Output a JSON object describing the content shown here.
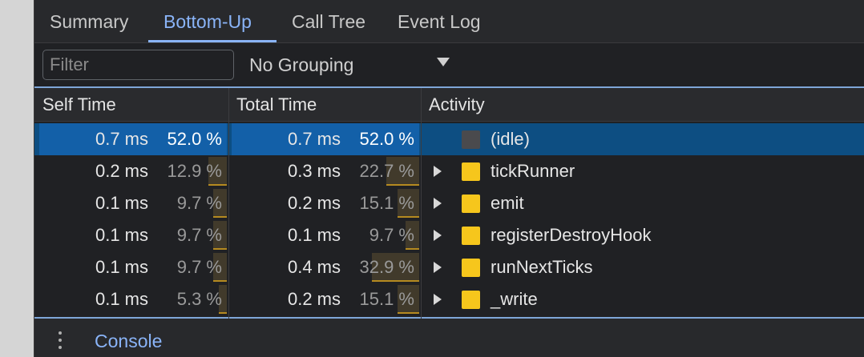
{
  "tabs": [
    {
      "label": "Summary",
      "active": false
    },
    {
      "label": "Bottom-Up",
      "active": true
    },
    {
      "label": "Call Tree",
      "active": false
    },
    {
      "label": "Event Log",
      "active": false
    }
  ],
  "toolbar": {
    "filter_placeholder": "Filter",
    "filter_value": "",
    "grouping_selected": "No Grouping"
  },
  "table": {
    "columns": [
      "Self Time",
      "Total Time",
      "Activity"
    ],
    "rows": [
      {
        "self_ms": "0.7 ms",
        "self_pct": "52.0 %",
        "self_frac": 0.52,
        "total_ms": "0.7 ms",
        "total_pct": "52.0 %",
        "total_frac": 0.52,
        "activity": "(idle)",
        "expandable": false,
        "swatch": "#4a4a4d",
        "selected": true
      },
      {
        "self_ms": "0.2 ms",
        "self_pct": "12.9 %",
        "self_frac": 0.129,
        "total_ms": "0.3 ms",
        "total_pct": "22.7 %",
        "total_frac": 0.227,
        "activity": "tickRunner",
        "expandable": true,
        "swatch": "#f6c61c",
        "selected": false
      },
      {
        "self_ms": "0.1 ms",
        "self_pct": "9.7 %",
        "self_frac": 0.097,
        "total_ms": "0.2 ms",
        "total_pct": "15.1 %",
        "total_frac": 0.151,
        "activity": "emit",
        "expandable": true,
        "swatch": "#f6c61c",
        "selected": false
      },
      {
        "self_ms": "0.1 ms",
        "self_pct": "9.7 %",
        "self_frac": 0.097,
        "total_ms": "0.1 ms",
        "total_pct": "9.7 %",
        "total_frac": 0.097,
        "activity": "registerDestroyHook",
        "expandable": true,
        "swatch": "#f6c61c",
        "selected": false
      },
      {
        "self_ms": "0.1 ms",
        "self_pct": "9.7 %",
        "self_frac": 0.097,
        "total_ms": "0.4 ms",
        "total_pct": "32.9 %",
        "total_frac": 0.329,
        "activity": "runNextTicks",
        "expandable": true,
        "swatch": "#f6c61c",
        "selected": false
      },
      {
        "self_ms": "0.1 ms",
        "self_pct": "5.3 %",
        "self_frac": 0.053,
        "total_ms": "0.2 ms",
        "total_pct": "15.1 %",
        "total_frac": 0.151,
        "activity": "_write",
        "expandable": true,
        "swatch": "#f6c61c",
        "selected": false
      }
    ]
  },
  "drawer": {
    "menu_icon": "more-vertical-icon",
    "console_label": "Console"
  },
  "colors": {
    "accent": "#8ab4f8",
    "selection": "#0d4e82",
    "selection_cell": "#1360a8",
    "scripting": "#f6c61c"
  }
}
